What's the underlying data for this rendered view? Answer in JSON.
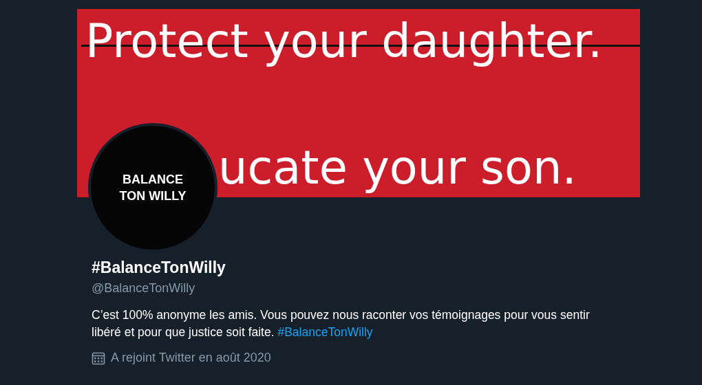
{
  "banner": {
    "headline": "Protect your daughter.",
    "headline_struck": true,
    "subline": "ucate your son."
  },
  "avatar": {
    "lines": [
      "BALANCE",
      "TON WILLY"
    ]
  },
  "profile": {
    "name": "#BalanceTonWilly",
    "handle": "@BalanceTonWilly",
    "bio": "C’est 100% anonyme les amis. Vous pouvez nous raconter vos témoignages pour vous sentir libéré et pour que justice soit faite.",
    "bio_hashtag": "#BalanceTonWilly",
    "joined": "A rejoint Twitter en août 2020"
  }
}
